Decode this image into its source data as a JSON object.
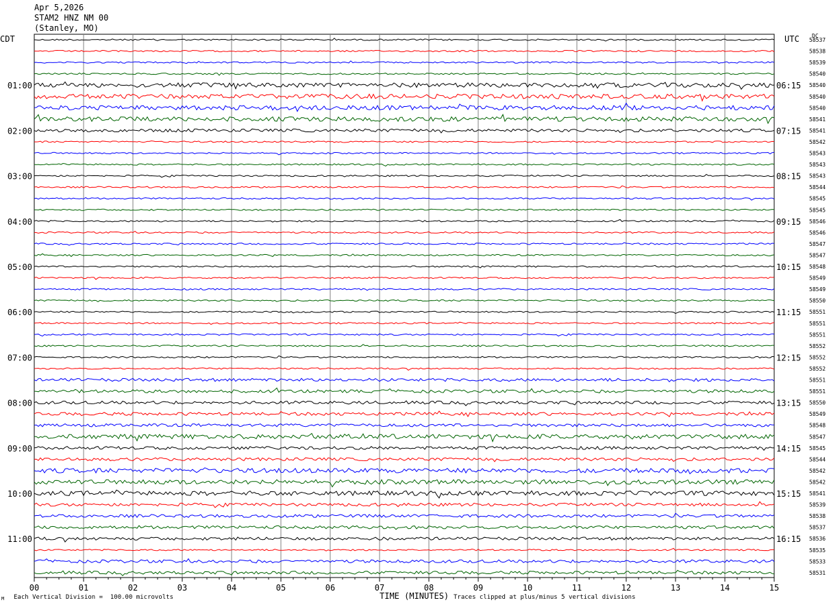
{
  "header": {
    "date": "Apr 5,2026",
    "station": "STAM2 HNZ NM 00",
    "location": "(Stanley, MO)"
  },
  "left_timezone": "CDT",
  "right_timezone": "UTC",
  "dc_header": "DC",
  "footer": {
    "scale_note": "Each Vertical Division =  100.00 microvolts",
    "axis_title": "TIME (MINUTES)",
    "clip_note": "Traces clipped at plus/minus 5 vertical divisions",
    "corner_mark": "M"
  },
  "colors": [
    "#000000",
    "#ff0000",
    "#0000ff",
    "#006400"
  ],
  "chart_data": {
    "type": "line",
    "title": "STAM2 HNZ NM 00",
    "xlabel": "TIME (MINUTES)",
    "xlim": [
      0,
      15
    ],
    "x_ticks": [
      "00",
      "01",
      "02",
      "03",
      "04",
      "05",
      "06",
      "07",
      "08",
      "09",
      "10",
      "11",
      "12",
      "13",
      "14",
      "15"
    ],
    "grid": true,
    "left_time_labels": [
      "01:00",
      "02:00",
      "03:00",
      "04:00",
      "05:00",
      "06:00",
      "07:00",
      "08:00",
      "09:00",
      "10:00",
      "11:00"
    ],
    "right_time_labels": [
      "06:15",
      "07:15",
      "08:15",
      "09:15",
      "10:15",
      "11:15",
      "12:15",
      "13:15",
      "14:15",
      "15:15",
      "16:15"
    ],
    "dc_values": [
      "58537",
      "58538",
      "58539",
      "58540",
      "58540",
      "58540",
      "58540",
      "58541",
      "58541",
      "58542",
      "58543",
      "58543",
      "58543",
      "58544",
      "58545",
      "58545",
      "58546",
      "58546",
      "58547",
      "58547",
      "58548",
      "58549",
      "58549",
      "58550",
      "58551",
      "58551",
      "58551",
      "58552",
      "58552",
      "58552",
      "58551",
      "58551",
      "58550",
      "58549",
      "58548",
      "58547",
      "58545",
      "58544",
      "58542",
      "58542",
      "58541",
      "58539",
      "58538",
      "58537",
      "58536",
      "58535",
      "58533",
      "58531"
    ],
    "trace_amplitude": [
      1,
      1,
      1,
      1,
      3,
      3,
      3,
      3,
      2,
      1,
      1,
      1,
      1,
      1,
      1,
      1,
      1,
      1,
      1,
      1,
      1,
      1,
      1,
      1,
      1,
      1,
      1,
      1,
      1,
      1,
      2,
      2,
      2,
      2,
      2,
      3,
      2,
      2,
      3,
      3,
      3,
      2,
      2,
      2,
      2,
      1,
      2,
      2
    ]
  }
}
